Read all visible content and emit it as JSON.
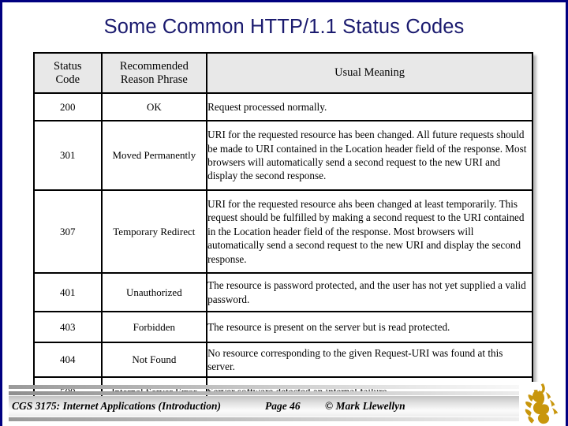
{
  "slide": {
    "title": "Some Common HTTP/1.1 Status Codes",
    "title_color": "#1b1b6f",
    "border_color": "#000080",
    "background": "#ffffff"
  },
  "table": {
    "header_background": "#e8e8e8",
    "headers": {
      "status_code": "Status\nCode",
      "status_code_line1": "Status",
      "status_code_line2": "Code",
      "reason_phrase_line1": "Recommended",
      "reason_phrase_line2": "Reason Phrase",
      "usual_meaning": "Usual Meaning"
    },
    "rows": [
      {
        "code": "200",
        "phrase": "OK",
        "meaning": "Request processed normally."
      },
      {
        "code": "301",
        "phrase": "Moved Permanently",
        "meaning": "URI for the requested resource has been changed.  All future requests should be made to URI contained in the Location header field of the response.  Most browsers will automatically send a second request to the new URI and display the second response."
      },
      {
        "code": "307",
        "phrase": "Temporary Redirect",
        "meaning": "URI for the requested resource ahs been changed at least temporarily.  This request should be fulfilled by making a second request to the URI contained in the Location header field of the response.  Most browsers will automatically send a second request to the new URI and display the second response."
      },
      {
        "code": "401",
        "phrase": "Unauthorized",
        "meaning": "The resource is password protected, and the user has not yet supplied a valid password."
      },
      {
        "code": "403",
        "phrase": "Forbidden",
        "meaning": "The resource is present on the server but is read protected."
      },
      {
        "code": "404",
        "phrase": "Not Found",
        "meaning": "No resource corresponding to the given Request-URI was found at this server."
      },
      {
        "code": "500",
        "phrase": "Internal Server Error",
        "meaning": "Server software detected an internal failure."
      }
    ]
  },
  "footer": {
    "course": "CGS 3175: Internet Applications (Introduction)",
    "page": "Page 46",
    "author": "© Mark Llewellyn",
    "logo_name": "ucf-pegasus-logo",
    "logo_color": "#c8960c"
  }
}
